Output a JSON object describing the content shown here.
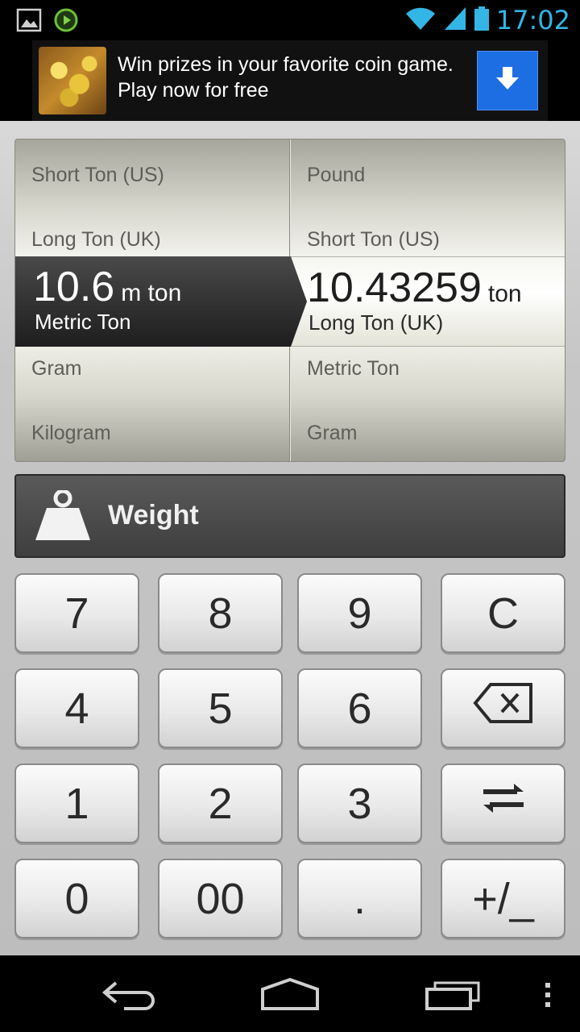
{
  "status_bar": {
    "time": "17:02",
    "icons": [
      "image-icon",
      "media-play-icon",
      "wifi-icon",
      "signal-icon",
      "battery-icon"
    ],
    "accent_color": "#33b5e5"
  },
  "ad": {
    "text": "Win prizes in your favorite coin game. Play now for free",
    "button_icon": "download-icon",
    "button_color": "#1e6ee3"
  },
  "converter": {
    "from": {
      "above": [
        "Short Ton (US)",
        "Long Ton (UK)"
      ],
      "value": "10.6",
      "unit": "m ton",
      "name": "Metric Ton",
      "below": [
        "Gram",
        "Kilogram"
      ]
    },
    "to": {
      "above": [
        "Pound",
        "Short Ton (US)"
      ],
      "value": "10.43259",
      "unit": "ton",
      "name": "Long Ton (UK)",
      "below": [
        "Metric Ton",
        "Gram"
      ]
    }
  },
  "category": {
    "label": "Weight",
    "icon": "weight-icon"
  },
  "keypad": {
    "rows": [
      [
        "7",
        "8",
        "9",
        "C"
      ],
      [
        "4",
        "5",
        "6",
        "backspace-icon"
      ],
      [
        "1",
        "2",
        "3",
        "swap-icon"
      ],
      [
        "0",
        "00",
        ".",
        "+/_"
      ]
    ]
  },
  "nav_bar": {
    "icons": [
      "back-icon",
      "home-icon",
      "recent-apps-icon",
      "overflow-menu-icon"
    ]
  }
}
